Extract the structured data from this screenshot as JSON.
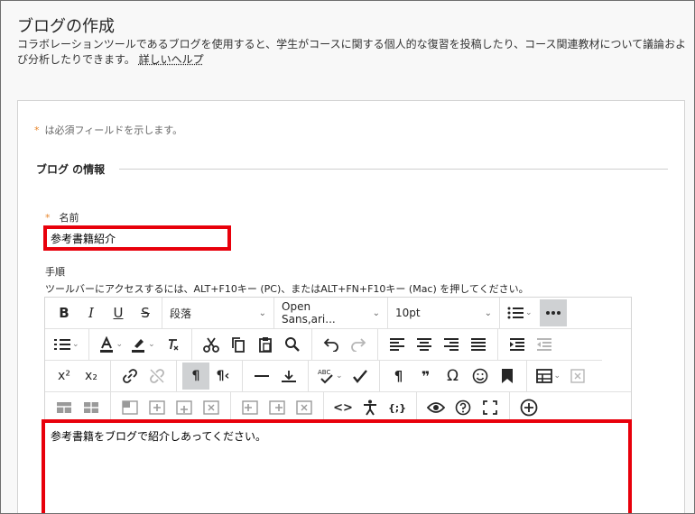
{
  "page": {
    "title": "ブログの作成",
    "description": "コラボレーションツールであるブログを使用すると、学生がコースに関する個人的な復習を投稿したり、コース関連教材について議論および分析したりできます。",
    "help_link": "詳しいヘルプ"
  },
  "form": {
    "required_star": "*",
    "required_note": "は必須フィールドを示します。",
    "section_title": "ブログ の情報",
    "name_label": "名前",
    "name_value": "参考書籍紹介",
    "steps_label": "手順",
    "steps_hint": "ツールバーにアクセスするには、ALT+F10キー (PC)、またはALT+FN+F10キー (Mac) を押してください。",
    "editor_text": "参考書籍をブログで紹介しあってください。"
  },
  "toolbar": {
    "bold": "B",
    "italic": "I",
    "underline": "U",
    "strike": "S",
    "paragraph_format": "段落",
    "font_family": "Open Sans,ari...",
    "font_size": "10pt",
    "superscript": "x²",
    "subscript": "x₂",
    "pilcrow_ltr": "¶",
    "pilcrow_rtl": "¶‹",
    "paragraph_mark": "¶",
    "quote": "❞",
    "omega": "Ω",
    "code": "<>",
    "source": "{;}"
  },
  "colors": {
    "highlight_border": "#e8000b",
    "required_star": "#e8862d",
    "selected_button": "#cfd1d3"
  }
}
